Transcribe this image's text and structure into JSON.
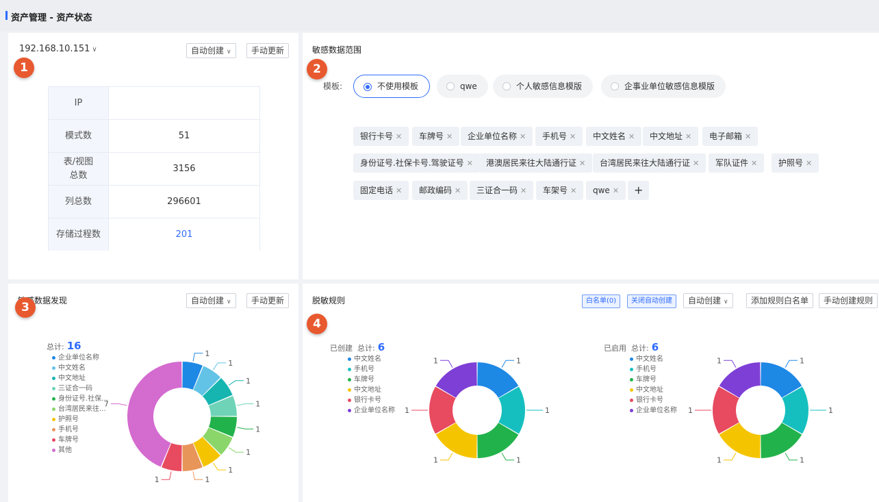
{
  "header": {
    "title": "资产管理 - 资产状态"
  },
  "card1": {
    "ip": "192.168.10.151",
    "btn_auto": "自动创建",
    "btn_manual": "手动更新",
    "rows": [
      {
        "label": "IP",
        "value": ""
      },
      {
        "label": "模式数",
        "value": "51"
      },
      {
        "label": "表/视图总数",
        "value": "3156"
      },
      {
        "label": "列总数",
        "value": "296601"
      },
      {
        "label": "存储过程数",
        "value": "201"
      }
    ]
  },
  "card2": {
    "title": "敏感数据范围",
    "template_label": "模板:",
    "templates": [
      "不使用模板",
      "qwe",
      "个人敏感信息模版",
      "企事业单位敏感信息模版"
    ],
    "selected_template": "不使用模板",
    "tags": [
      "银行卡号",
      "车牌号",
      "企业单位名称",
      "手机号",
      "中文姓名",
      "中文地址",
      "电子邮箱",
      "身份证号.社保卡号.驾驶证号",
      "港澳居民来往大陆通行证",
      "台湾居民来往大陆通行证",
      "军队证件",
      "护照号",
      "固定电话",
      "邮政编码",
      "三证合一码",
      "车架号",
      "qwe"
    ],
    "add_symbol": "+"
  },
  "card3": {
    "title": "敏感数据发现",
    "btn_auto": "自动创建",
    "btn_manual": "手动更新",
    "total_label": "总计:",
    "total_value": "16"
  },
  "card4": {
    "title": "脱敏规则",
    "btn_whitelist": "白名单(0)",
    "btn_close_auto": "关闭自动创建",
    "btn_auto": "自动创建",
    "btn_add_rule_whitelist": "添加规则白名单",
    "btn_manual_rule": "手动创建规则",
    "created_label": "已创建",
    "enabled_label": "已启用",
    "total_label": "总计:",
    "created_total": "6",
    "enabled_total": "6"
  },
  "icons": {
    "caret": "chevron-down-icon",
    "close": "close-icon"
  },
  "chart_data": [
    {
      "type": "pie",
      "title": "敏感数据发现",
      "donut": true,
      "categories": [
        "企业单位名称",
        "中文姓名",
        "中文地址",
        "三证合一码",
        "身份证号.社保...",
        "台湾居民来往...",
        "护照号",
        "手机号",
        "车牌号",
        "其他"
      ],
      "values": [
        1,
        1,
        1,
        1,
        1,
        1,
        1,
        1,
        1,
        7
      ],
      "colors": [
        "#1e88e5",
        "#62c3e6",
        "#16b5b0",
        "#6fd3b8",
        "#22b24c",
        "#8bd66a",
        "#f5c400",
        "#e8955a",
        "#e84a5f",
        "#d46bcf"
      ],
      "legend": "left"
    },
    {
      "type": "pie",
      "title": "已创建",
      "donut": true,
      "categories": [
        "中文姓名",
        "手机号",
        "车牌号",
        "中文地址",
        "银行卡号",
        "企业单位名称"
      ],
      "values": [
        1,
        1,
        1,
        1,
        1,
        1
      ],
      "colors": [
        "#1e88e5",
        "#16bfbf",
        "#22b24c",
        "#f5c400",
        "#e84a5f",
        "#7e3fd6"
      ],
      "legend": "left"
    },
    {
      "type": "pie",
      "title": "已启用",
      "donut": true,
      "categories": [
        "中文姓名",
        "手机号",
        "车牌号",
        "中文地址",
        "银行卡号",
        "企业单位名称"
      ],
      "values": [
        1,
        1,
        1,
        1,
        1,
        1
      ],
      "colors": [
        "#1e88e5",
        "#16bfbf",
        "#22b24c",
        "#f5c400",
        "#e84a5f",
        "#7e3fd6"
      ],
      "legend": "left"
    }
  ]
}
